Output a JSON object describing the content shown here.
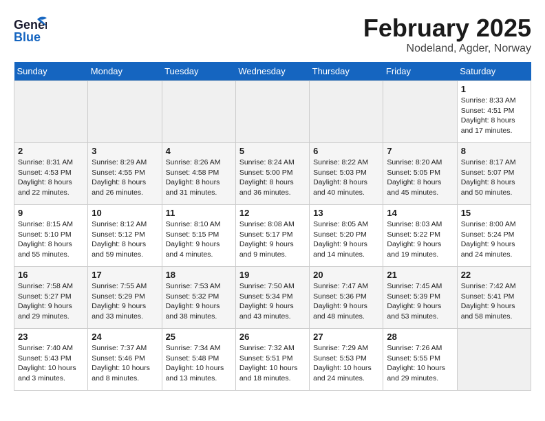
{
  "header": {
    "logo_line1": "General",
    "logo_line2": "Blue",
    "month": "February 2025",
    "location": "Nodeland, Agder, Norway"
  },
  "weekdays": [
    "Sunday",
    "Monday",
    "Tuesday",
    "Wednesday",
    "Thursday",
    "Friday",
    "Saturday"
  ],
  "weeks": [
    [
      {
        "day": "",
        "info": ""
      },
      {
        "day": "",
        "info": ""
      },
      {
        "day": "",
        "info": ""
      },
      {
        "day": "",
        "info": ""
      },
      {
        "day": "",
        "info": ""
      },
      {
        "day": "",
        "info": ""
      },
      {
        "day": "1",
        "info": "Sunrise: 8:33 AM\nSunset: 4:51 PM\nDaylight: 8 hours\nand 17 minutes."
      }
    ],
    [
      {
        "day": "2",
        "info": "Sunrise: 8:31 AM\nSunset: 4:53 PM\nDaylight: 8 hours\nand 22 minutes."
      },
      {
        "day": "3",
        "info": "Sunrise: 8:29 AM\nSunset: 4:55 PM\nDaylight: 8 hours\nand 26 minutes."
      },
      {
        "day": "4",
        "info": "Sunrise: 8:26 AM\nSunset: 4:58 PM\nDaylight: 8 hours\nand 31 minutes."
      },
      {
        "day": "5",
        "info": "Sunrise: 8:24 AM\nSunset: 5:00 PM\nDaylight: 8 hours\nand 36 minutes."
      },
      {
        "day": "6",
        "info": "Sunrise: 8:22 AM\nSunset: 5:03 PM\nDaylight: 8 hours\nand 40 minutes."
      },
      {
        "day": "7",
        "info": "Sunrise: 8:20 AM\nSunset: 5:05 PM\nDaylight: 8 hours\nand 45 minutes."
      },
      {
        "day": "8",
        "info": "Sunrise: 8:17 AM\nSunset: 5:07 PM\nDaylight: 8 hours\nand 50 minutes."
      }
    ],
    [
      {
        "day": "9",
        "info": "Sunrise: 8:15 AM\nSunset: 5:10 PM\nDaylight: 8 hours\nand 55 minutes."
      },
      {
        "day": "10",
        "info": "Sunrise: 8:12 AM\nSunset: 5:12 PM\nDaylight: 8 hours\nand 59 minutes."
      },
      {
        "day": "11",
        "info": "Sunrise: 8:10 AM\nSunset: 5:15 PM\nDaylight: 9 hours\nand 4 minutes."
      },
      {
        "day": "12",
        "info": "Sunrise: 8:08 AM\nSunset: 5:17 PM\nDaylight: 9 hours\nand 9 minutes."
      },
      {
        "day": "13",
        "info": "Sunrise: 8:05 AM\nSunset: 5:20 PM\nDaylight: 9 hours\nand 14 minutes."
      },
      {
        "day": "14",
        "info": "Sunrise: 8:03 AM\nSunset: 5:22 PM\nDaylight: 9 hours\nand 19 minutes."
      },
      {
        "day": "15",
        "info": "Sunrise: 8:00 AM\nSunset: 5:24 PM\nDaylight: 9 hours\nand 24 minutes."
      }
    ],
    [
      {
        "day": "16",
        "info": "Sunrise: 7:58 AM\nSunset: 5:27 PM\nDaylight: 9 hours\nand 29 minutes."
      },
      {
        "day": "17",
        "info": "Sunrise: 7:55 AM\nSunset: 5:29 PM\nDaylight: 9 hours\nand 33 minutes."
      },
      {
        "day": "18",
        "info": "Sunrise: 7:53 AM\nSunset: 5:32 PM\nDaylight: 9 hours\nand 38 minutes."
      },
      {
        "day": "19",
        "info": "Sunrise: 7:50 AM\nSunset: 5:34 PM\nDaylight: 9 hours\nand 43 minutes."
      },
      {
        "day": "20",
        "info": "Sunrise: 7:47 AM\nSunset: 5:36 PM\nDaylight: 9 hours\nand 48 minutes."
      },
      {
        "day": "21",
        "info": "Sunrise: 7:45 AM\nSunset: 5:39 PM\nDaylight: 9 hours\nand 53 minutes."
      },
      {
        "day": "22",
        "info": "Sunrise: 7:42 AM\nSunset: 5:41 PM\nDaylight: 9 hours\nand 58 minutes."
      }
    ],
    [
      {
        "day": "23",
        "info": "Sunrise: 7:40 AM\nSunset: 5:43 PM\nDaylight: 10 hours\nand 3 minutes."
      },
      {
        "day": "24",
        "info": "Sunrise: 7:37 AM\nSunset: 5:46 PM\nDaylight: 10 hours\nand 8 minutes."
      },
      {
        "day": "25",
        "info": "Sunrise: 7:34 AM\nSunset: 5:48 PM\nDaylight: 10 hours\nand 13 minutes."
      },
      {
        "day": "26",
        "info": "Sunrise: 7:32 AM\nSunset: 5:51 PM\nDaylight: 10 hours\nand 18 minutes."
      },
      {
        "day": "27",
        "info": "Sunrise: 7:29 AM\nSunset: 5:53 PM\nDaylight: 10 hours\nand 24 minutes."
      },
      {
        "day": "28",
        "info": "Sunrise: 7:26 AM\nSunset: 5:55 PM\nDaylight: 10 hours\nand 29 minutes."
      },
      {
        "day": "",
        "info": ""
      }
    ]
  ]
}
